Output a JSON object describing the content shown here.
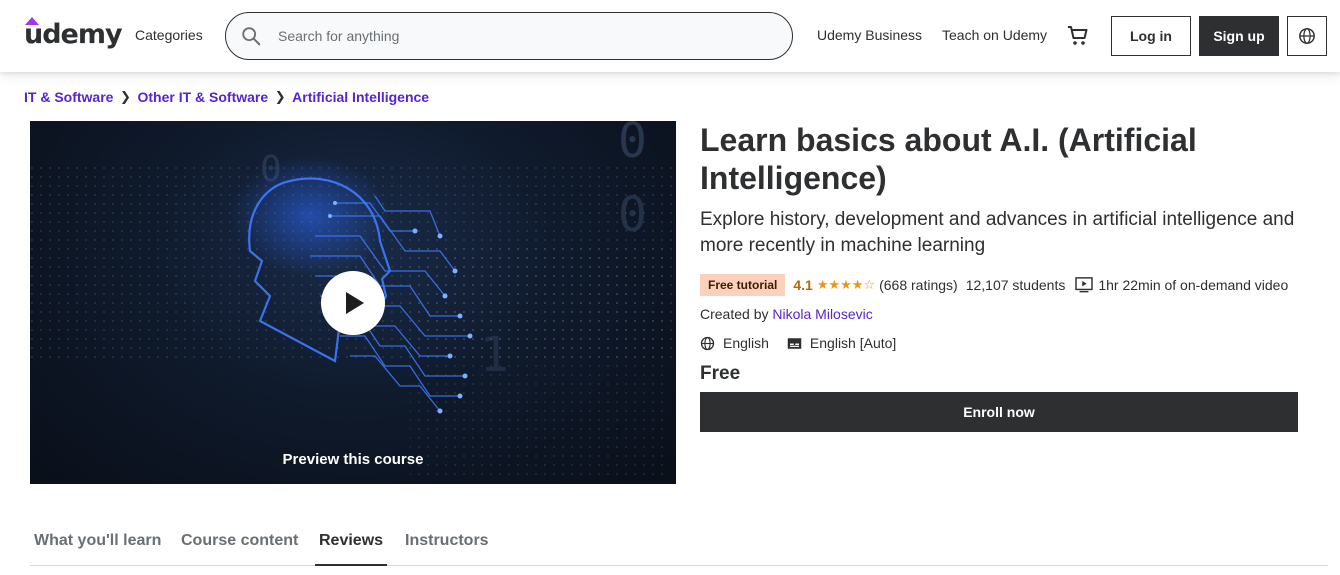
{
  "header": {
    "logo": "udemy",
    "categories_label": "Categories",
    "search_placeholder": "Search for anything",
    "udemy_business_label": "Udemy Business",
    "teach_label": "Teach on Udemy",
    "login_label": "Log in",
    "signup_label": "Sign up",
    "cart_icon": "cart-icon",
    "language_icon": "globe-icon"
  },
  "breadcrumb": [
    "IT & Software",
    "Other IT & Software",
    "Artificial Intelligence"
  ],
  "preview": {
    "label": "Preview this course",
    "play_icon": "play-icon"
  },
  "course": {
    "title": "Learn basics about A.I. (Artificial Intelligence)",
    "subtitle": "Explore history, development and advances in artificial intelligence and more recently in machine learning",
    "badge": "Free tutorial",
    "rating": "4.1",
    "stars_value": 4.1,
    "stars": "★★★★☆",
    "ratings_count": "(668 ratings)",
    "students": "12,107 students",
    "video_duration": "1hr 22min of on-demand video",
    "created_by_label": "Created by",
    "instructor": "Nikola Milosevic",
    "language": "English",
    "captions": "English [Auto]",
    "price": "Free",
    "enroll_label": "Enroll now"
  },
  "tabs": [
    {
      "label": "What you'll learn",
      "active": false
    },
    {
      "label": "Course content",
      "active": false
    },
    {
      "label": "Reviews",
      "active": true
    },
    {
      "label": "Instructors",
      "active": false
    }
  ],
  "colors": {
    "brand_purple": "#a435f0",
    "link_purple": "#5624d0",
    "dark": "#2d2f31",
    "rating_orange": "#b4690e",
    "badge_bg": "#fbd1b9"
  }
}
